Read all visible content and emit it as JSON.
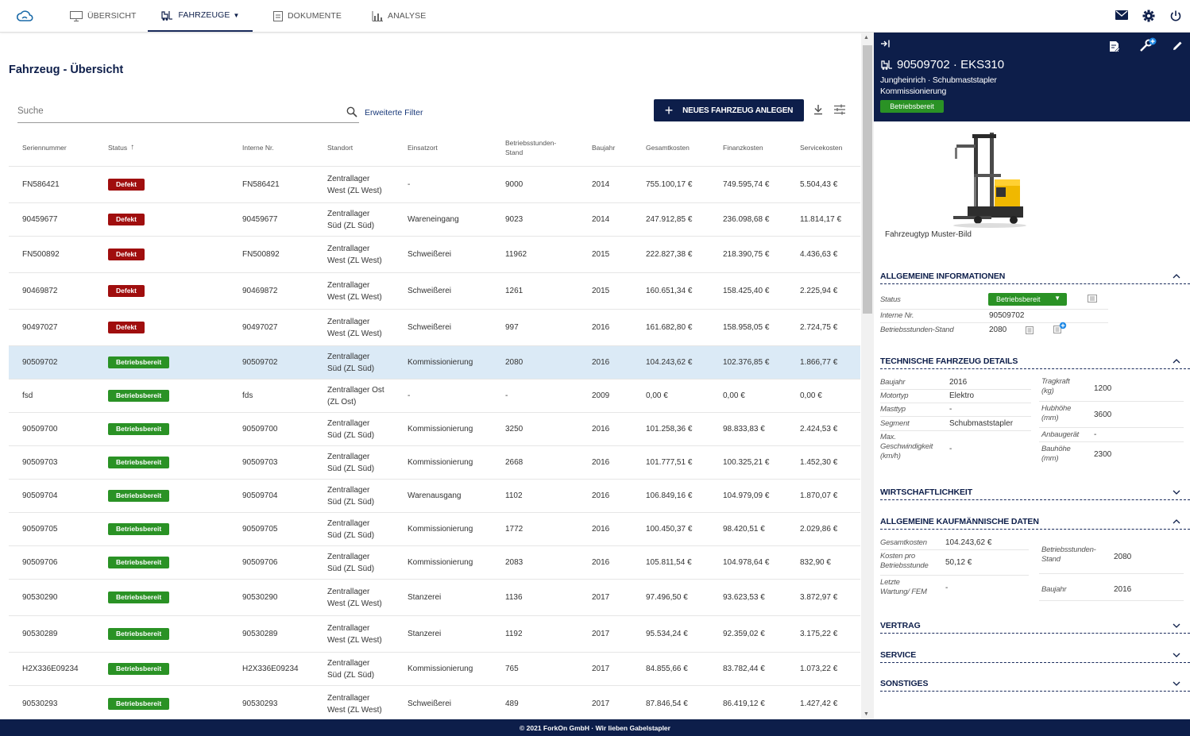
{
  "nav": {
    "tabs": [
      {
        "label": "ÜBERSICHT",
        "icon": "monitor-icon"
      },
      {
        "label": "FAHRZEUGE",
        "icon": "forklift-icon",
        "active": true
      },
      {
        "label": "DOKUMENTE",
        "icon": "document-icon"
      },
      {
        "label": "ANALYSE",
        "icon": "bar-chart-icon"
      }
    ],
    "right_icons": [
      "mail-icon",
      "gear-icon",
      "power-icon"
    ]
  },
  "page": {
    "title": "Fahrzeug - Übersicht",
    "search_placeholder": "Suche",
    "extended_filter": "Erweiterte Filter",
    "new_vehicle_button": "NEUES FAHRZEUG ANLEGEN"
  },
  "table": {
    "headers": [
      "Seriennummer",
      "Status",
      "Interne Nr.",
      "Standort",
      "Einsatzort",
      "Betriebsstunden-Stand",
      "Baujahr",
      "Gesamtkosten",
      "Finanzkosten",
      "Servicekosten"
    ],
    "sort_indicator": "↑",
    "rows": [
      {
        "serial": "FN586421",
        "status": "Defekt",
        "internal": "FN586421",
        "location": "Zentrallager West (ZL West)",
        "site": "-",
        "hours": "9000",
        "year": "2014",
        "total": "755.100,17 €",
        "finance": "749.595,74 €",
        "service": "5.504,43 €"
      },
      {
        "serial": "90459677",
        "status": "Defekt",
        "internal": "90459677",
        "location": "Zentrallager Süd (ZL Süd)",
        "site": "Wareneingang",
        "hours": "9023",
        "year": "2014",
        "total": "247.912,85 €",
        "finance": "236.098,68 €",
        "service": "11.814,17 €"
      },
      {
        "serial": "FN500892",
        "status": "Defekt",
        "internal": "FN500892",
        "location": "Zentrallager West (ZL West)",
        "site": "Schweißerei",
        "hours": "11962",
        "year": "2015",
        "total": "222.827,38 €",
        "finance": "218.390,75 €",
        "service": "4.436,63 €"
      },
      {
        "serial": "90469872",
        "status": "Defekt",
        "internal": "90469872",
        "location": "Zentrallager West (ZL West)",
        "site": "Schweißerei",
        "hours": "1261",
        "year": "2015",
        "total": "160.651,34 €",
        "finance": "158.425,40 €",
        "service": "2.225,94 €"
      },
      {
        "serial": "90497027",
        "status": "Defekt",
        "internal": "90497027",
        "location": "Zentrallager West (ZL West)",
        "site": "Schweißerei",
        "hours": "997",
        "year": "2016",
        "total": "161.682,80 €",
        "finance": "158.958,05 €",
        "service": "2.724,75 €"
      },
      {
        "serial": "90509702",
        "status": "Betriebsbereit",
        "internal": "90509702",
        "location": "Zentrallager Süd (ZL Süd)",
        "site": "Kommissionierung",
        "hours": "2080",
        "year": "2016",
        "total": "104.243,62 €",
        "finance": "102.376,85 €",
        "service": "1.866,77 €",
        "selected": true
      },
      {
        "serial": "fsd",
        "status": "Betriebsbereit",
        "internal": "fds",
        "location": "Zentrallager Ost (ZL Ost)",
        "site": "-",
        "hours": "-",
        "year": "2009",
        "total": "0,00 €",
        "finance": "0,00 €",
        "service": "0,00 €"
      },
      {
        "serial": "90509700",
        "status": "Betriebsbereit",
        "internal": "90509700",
        "location": "Zentrallager Süd (ZL Süd)",
        "site": "Kommissionierung",
        "hours": "3250",
        "year": "2016",
        "total": "101.258,36 €",
        "finance": "98.833,83 €",
        "service": "2.424,53 €"
      },
      {
        "serial": "90509703",
        "status": "Betriebsbereit",
        "internal": "90509703",
        "location": "Zentrallager Süd (ZL Süd)",
        "site": "Kommissionierung",
        "hours": "2668",
        "year": "2016",
        "total": "101.777,51 €",
        "finance": "100.325,21 €",
        "service": "1.452,30 €"
      },
      {
        "serial": "90509704",
        "status": "Betriebsbereit",
        "internal": "90509704",
        "location": "Zentrallager Süd (ZL Süd)",
        "site": "Warenausgang",
        "hours": "1102",
        "year": "2016",
        "total": "106.849,16 €",
        "finance": "104.979,09 €",
        "service": "1.870,07 €"
      },
      {
        "serial": "90509705",
        "status": "Betriebsbereit",
        "internal": "90509705",
        "location": "Zentrallager Süd (ZL Süd)",
        "site": "Kommissionierung",
        "hours": "1772",
        "year": "2016",
        "total": "100.450,37 €",
        "finance": "98.420,51 €",
        "service": "2.029,86 €"
      },
      {
        "serial": "90509706",
        "status": "Betriebsbereit",
        "internal": "90509706",
        "location": "Zentrallager Süd (ZL Süd)",
        "site": "Kommissionierung",
        "hours": "2083",
        "year": "2016",
        "total": "105.811,54 €",
        "finance": "104.978,64 €",
        "service": "832,90 €"
      },
      {
        "serial": "90530290",
        "status": "Betriebsbereit",
        "internal": "90530290",
        "location": "Zentrallager West (ZL West)",
        "site": "Stanzerei",
        "hours": "1136",
        "year": "2017",
        "total": "97.496,50 €",
        "finance": "93.623,53 €",
        "service": "3.872,97 €"
      },
      {
        "serial": "90530289",
        "status": "Betriebsbereit",
        "internal": "90530289",
        "location": "Zentrallager West (ZL West)",
        "site": "Stanzerei",
        "hours": "1192",
        "year": "2017",
        "total": "95.534,24 €",
        "finance": "92.359,02 €",
        "service": "3.175,22 €"
      },
      {
        "serial": "H2X336E09234",
        "status": "Betriebsbereit",
        "internal": "H2X336E09234",
        "location": "Zentrallager Süd (ZL Süd)",
        "site": "Kommissionierung",
        "hours": "765",
        "year": "2017",
        "total": "84.855,66 €",
        "finance": "83.782,44 €",
        "service": "1.073,22 €"
      },
      {
        "serial": "90530293",
        "status": "Betriebsbereit",
        "internal": "90530293",
        "location": "Zentrallager West (ZL West)",
        "site": "Schweißerei",
        "hours": "489",
        "year": "2017",
        "total": "87.846,54 €",
        "finance": "86.419,12 €",
        "service": "1.427,42 €"
      }
    ]
  },
  "panel": {
    "title": "90509702 · EKS310",
    "subtitle1": "Jungheinrich · Schubmaststapler",
    "subtitle2": "Kommissionierung",
    "badge": "Betriebsbereit",
    "image_caption": "Fahrzeugtyp Muster-Bild",
    "sections": {
      "general": "ALLGEMEINE INFORMATIONEN",
      "technical": "TECHNISCHE FAHRZEUG DETAILS",
      "economy": "WIRTSCHAFTLICHKEIT",
      "commercial": "ALLGEMEINE KAUFMÄNNISCHE DATEN",
      "contract": "VERTRAG",
      "service": "SERVICE",
      "other": "SONSTIGES"
    },
    "general": {
      "status_label": "Status",
      "status_value": "Betriebsbereit",
      "internal_label": "Interne Nr.",
      "internal_value": "90509702",
      "hours_label": "Betriebsstunden-Stand",
      "hours_value": "2080"
    },
    "technical": {
      "baujahr_label": "Baujahr",
      "baujahr_value": "2016",
      "motor_label": "Motortyp",
      "motor_value": "Elektro",
      "mast_label": "Masttyp",
      "mast_value": "-",
      "segment_label": "Segment",
      "segment_value": "Schubmaststapler",
      "speed_label": "Max. Geschwindigkeit (km/h)",
      "speed_value": "-",
      "tragkraft_label": "Tragkraft (kg)",
      "tragkraft_value": "1200",
      "hubhoehe_label": "Hubhöhe (mm)",
      "hubhoehe_value": "3600",
      "anbau_label": "Anbaugerät",
      "anbau_value": "-",
      "bauhoehe_label": "Bauhöhe (mm)",
      "bauhoehe_value": "2300"
    },
    "commercial": {
      "total_label": "Gesamtkosten",
      "total_value": "104.243,62 €",
      "perhour_label": "Kosten pro Betriebsstunde",
      "perhour_value": "50,12 €",
      "lastservice_label": "Letzte Wartung/ FEM",
      "lastservice_value": "-",
      "hours_label": "Betriebsstunden-Stand",
      "hours_value": "2080",
      "baujahr_label": "Baujahr",
      "baujahr_value": "2016"
    }
  },
  "footer": "© 2021 ForkOn GmbH · Wir lieben Gabelstapler",
  "colors": {
    "navy": "#0d1e4a",
    "defect": "#a00e0e",
    "ready": "#2a9225",
    "selected_row": "#dbeaf6"
  }
}
